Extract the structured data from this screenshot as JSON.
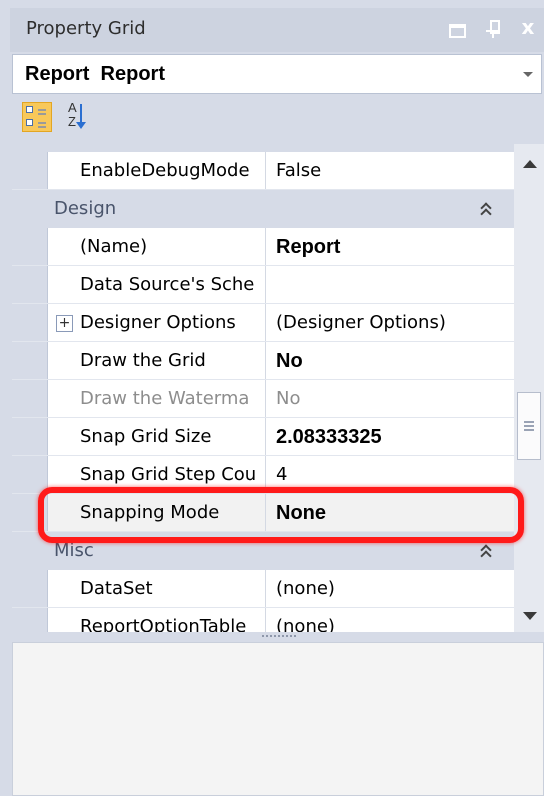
{
  "window": {
    "title": "Property Grid",
    "controls": [
      "minimize",
      "pin",
      "close"
    ],
    "close_glyph": "x"
  },
  "selector": {
    "text": "Report  Report"
  },
  "toolbar": {
    "buttons": [
      {
        "name": "categorized-icon",
        "active": true
      },
      {
        "name": "sort-alphabetical-icon",
        "active": false
      }
    ],
    "alpha_top": "A",
    "alpha_bottom": "Z"
  },
  "grid": {
    "rows": [
      {
        "type": "property",
        "name": "EnableDebugMode",
        "value": "False"
      },
      {
        "type": "category",
        "label": "Design"
      },
      {
        "type": "property",
        "name": "(Name)",
        "value": "Report",
        "bold": true
      },
      {
        "type": "property",
        "name": "Data Source's Sche",
        "value": ""
      },
      {
        "type": "property",
        "name": "Designer Options",
        "value": "(Designer Options)",
        "expandable": true,
        "expander": "+"
      },
      {
        "type": "property",
        "name": "Draw the Grid",
        "value": "No",
        "bold": true
      },
      {
        "type": "property",
        "name": "Draw the Waterma",
        "value": "No",
        "disabled": true
      },
      {
        "type": "property",
        "name": "Snap Grid Size",
        "value": "2.08333325",
        "bold": true
      },
      {
        "type": "property",
        "name": "Snap Grid Step Cou",
        "value": "4"
      },
      {
        "type": "property",
        "name": "Snapping Mode",
        "value": "None",
        "bold": true,
        "highlighted": true
      },
      {
        "type": "category",
        "label": "Misc"
      },
      {
        "type": "property",
        "name": "DataSet",
        "value": "(none)"
      },
      {
        "type": "property",
        "name": "ReportOptionTable",
        "value": "(none)"
      }
    ]
  },
  "colors": {
    "panel": "#d6dbe7",
    "highlight": "#ff1a1a",
    "toolbar_active": "#f8c85a"
  }
}
